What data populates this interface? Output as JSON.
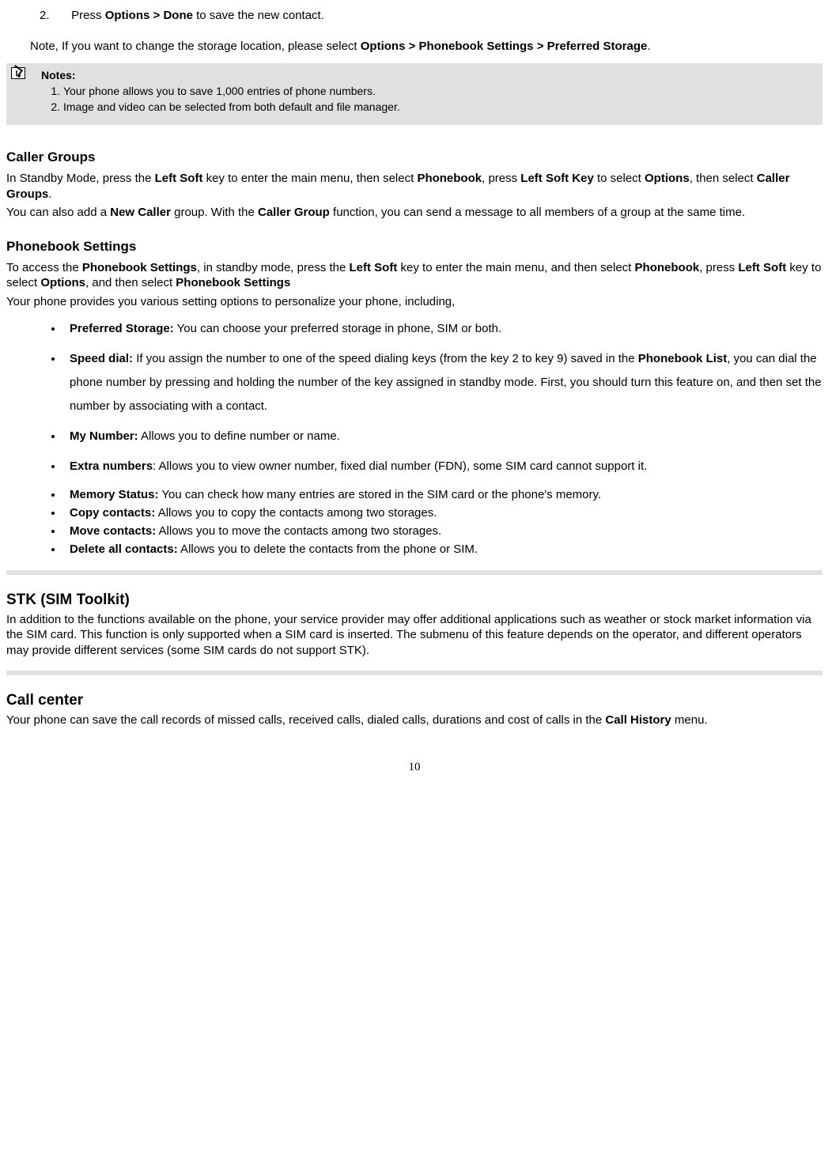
{
  "step2": {
    "num": "2.",
    "text_pre": "Press ",
    "bold": "Options > Done",
    "text_post": " to save the new contact."
  },
  "storage_note": {
    "pre": "Note, If you want to change the storage location, please select ",
    "bold1": "Options > Phonebook Settings > Preferred Storage",
    "post": "."
  },
  "notes_box": {
    "title": "Notes:",
    "items": [
      "Your phone allows you to save 1,000 entries of phone numbers.",
      "Image and video can be selected from both default and file manager."
    ]
  },
  "caller_groups": {
    "heading": "Caller Groups",
    "p1": {
      "t1": "In Standby Mode, press the ",
      "b1": "Left Soft",
      "t2": " key to enter the main menu, then select ",
      "b2": "Phonebook",
      "t3": ", press ",
      "b3": "Left Soft Key",
      "t4": " to select ",
      "b4": "Options",
      "t5": ", then select ",
      "b5": "Caller Groups",
      "t6": "."
    },
    "p2": {
      "t1": "You can also add a ",
      "b1": "New Caller",
      "t2": " group. With the ",
      "b2": "Caller Group",
      "t3": " function, you can send a message to all members of a group at the same time."
    }
  },
  "phonebook_settings": {
    "heading": "Phonebook Settings",
    "p1": {
      "t1": "To access the ",
      "b1": "Phonebook Settings",
      "t2": ", in standby mode, press the ",
      "b2": "Left Soft",
      "t3": " key to enter the main menu, and then select ",
      "b3": "Phonebook",
      "t4": ", press ",
      "b4": "Left Soft",
      "t5": " key to select ",
      "b5": "Options",
      "t6": ", and then select ",
      "b6": "Phonebook Settings"
    },
    "p2": "Your phone provides you various setting options to personalize your phone, including,",
    "bullets_spaced": [
      {
        "b": "Preferred Storage:",
        "t": " You can choose your preferred storage in phone, SIM or both."
      },
      {
        "b": "Speed dial:",
        "t": " If you assign the number to one of the speed dialing keys (from the key 2 to key 9) saved in the ",
        "b2": "Phonebook List",
        "t2": ", you can dial the phone number by pressing and holding the number of the key assigned in standby mode. First, you should turn this feature on, and then set the number by associating with a contact."
      },
      {
        "b": "My Number:",
        "t": " Allows you to define number or name."
      },
      {
        "b": "Extra numbers",
        "t": ": Allows you to view owner number, fixed dial number (FDN), some SIM card cannot support it."
      }
    ],
    "bullets_tight": [
      {
        "b": "Memory Status:",
        "t": " You can check how many entries are stored in the SIM card or the phone's memory."
      },
      {
        "b": "Copy contacts:",
        "t": " Allows you to copy the contacts among two storages."
      },
      {
        "b": "Move contacts:",
        "t": " Allows you to move the contacts among two storages."
      },
      {
        "b": "Delete all contacts:",
        "t": " Allows you to delete the contacts from the phone or SIM."
      }
    ]
  },
  "stk": {
    "heading": "STK (SIM Toolkit)",
    "p": "In addition to the functions available on the phone, your service provider may offer additional applications such as weather or stock market information via the SIM card. This function is only supported when a SIM card is inserted. The submenu of this feature depends on the operator, and different operators may provide different services (some SIM cards do not support STK)."
  },
  "call_center": {
    "heading": "Call center",
    "p": {
      "t1": "Your phone can save the call records of missed calls, received calls, dialed calls, durations and cost of calls in the ",
      "b1": "Call History",
      "t2": " menu."
    }
  },
  "page_number": "10"
}
